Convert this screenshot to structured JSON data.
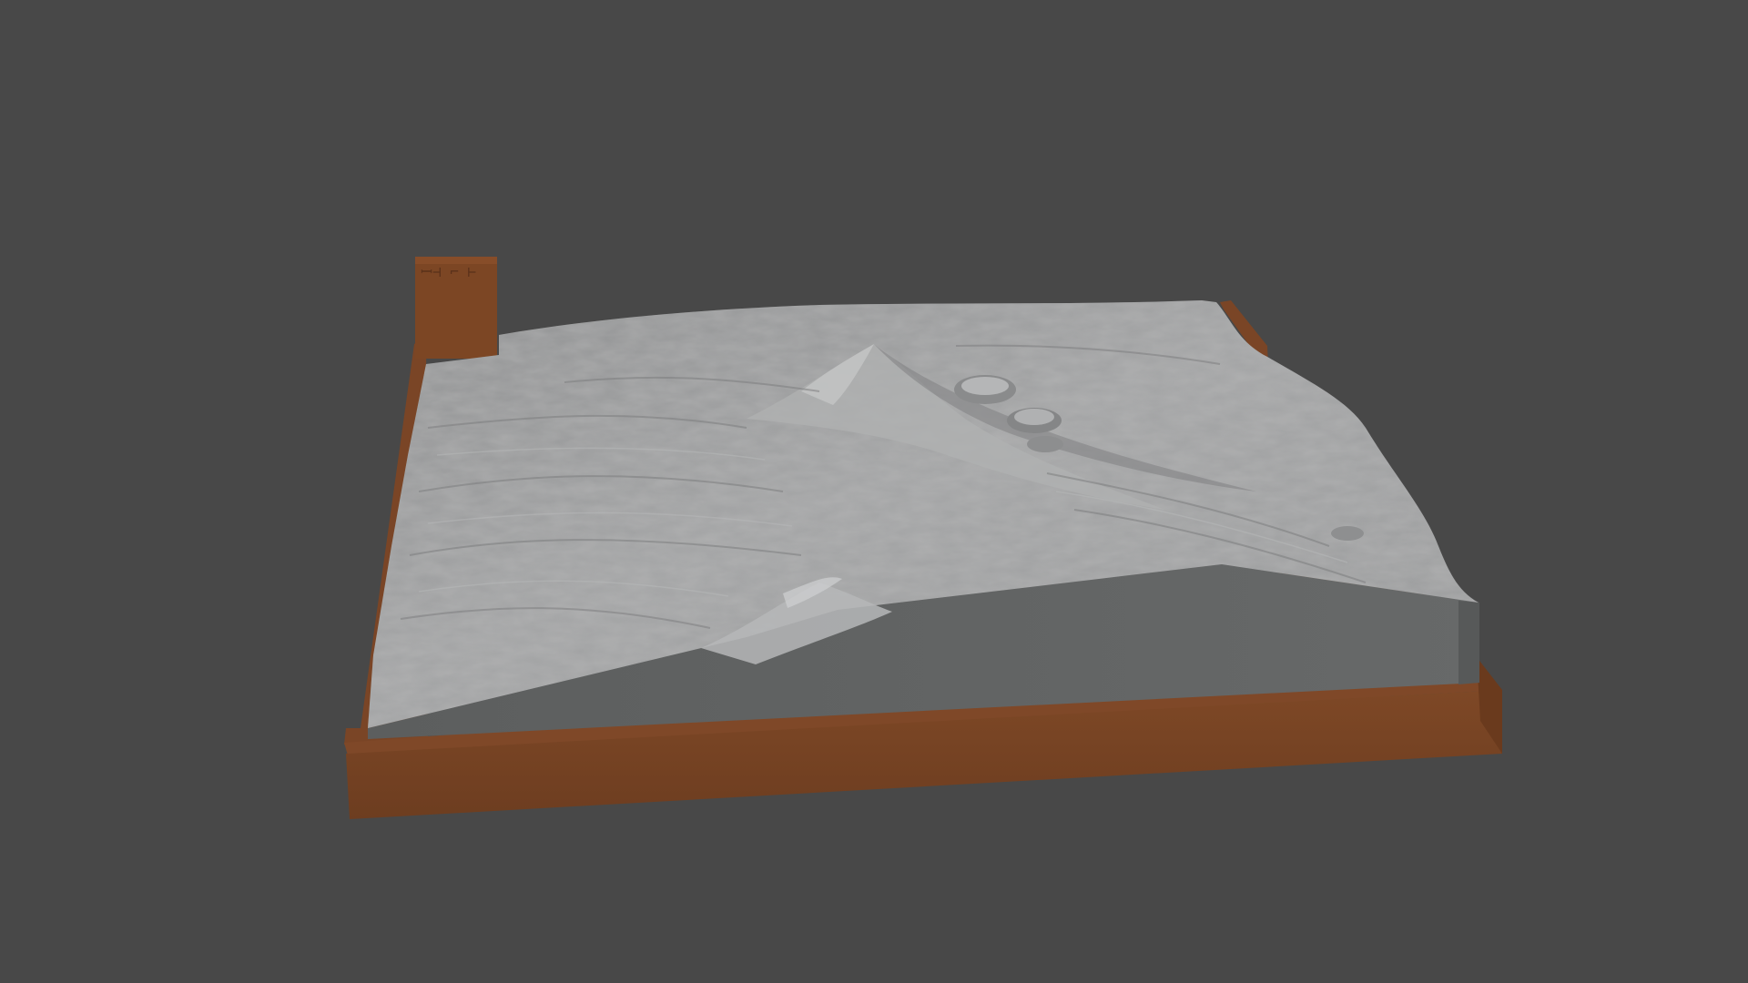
{
  "viewport": {
    "background": "#484848"
  },
  "model": {
    "base_color": "#7a4526",
    "base_shadow_color": "#5e351d",
    "terrain_color": "#9a9b9c",
    "terrain_side_color": "#606262",
    "label_block_color": "#7c4624",
    "label_block_glyphs": "icon-engraving"
  }
}
